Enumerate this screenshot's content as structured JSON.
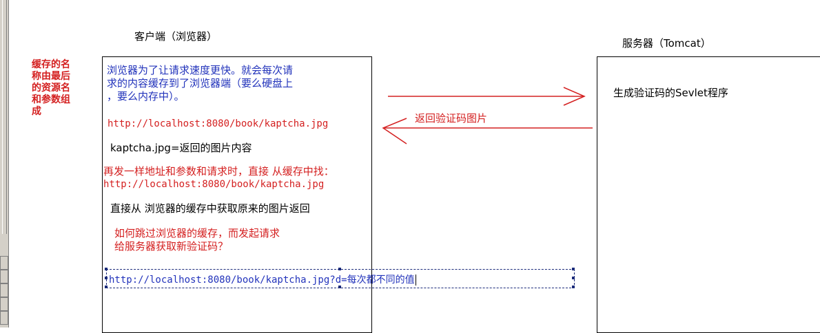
{
  "client": {
    "title": "客户端（浏览器）"
  },
  "server": {
    "title": "服务器（Tomcat）",
    "program": "生成验证码的Sevlet程序"
  },
  "cache_note": [
    "缓存的名",
    "称由最后",
    "的资源名",
    "和参数组",
    "成"
  ],
  "browser_text": {
    "lines": [
      "浏览器为了让请求速度更快。就会每次请",
      "求的内容缓存到了浏览器端（要么硬盘上",
      "，要么内存中）。"
    ],
    "url1": "http://localhost:8080/book/kaptcha.jpg",
    "kaptcha_desc": "kaptcha.jpg=返回的图片内容",
    "resend_note": "再发一样地址和参数和请求时，直接 从缓存中找：",
    "url2": "http://localhost:8080/book/kaptcha.jpg",
    "return_cache": "直接从 浏览器的缓存中获取原来的图片返回",
    "bypass_q": [
      "如何跳过浏览器的缓存，而发起请求",
      "给服务器获取新验证码？"
    ],
    "url3": "http://localhost:8080/book/kaptcha.jpg?d=每次都不同的值"
  },
  "arrow_label": "返回验证码图片",
  "colors": {
    "blue": "#2233bb",
    "red": "#d42020",
    "selection": "#1a2a7a"
  }
}
